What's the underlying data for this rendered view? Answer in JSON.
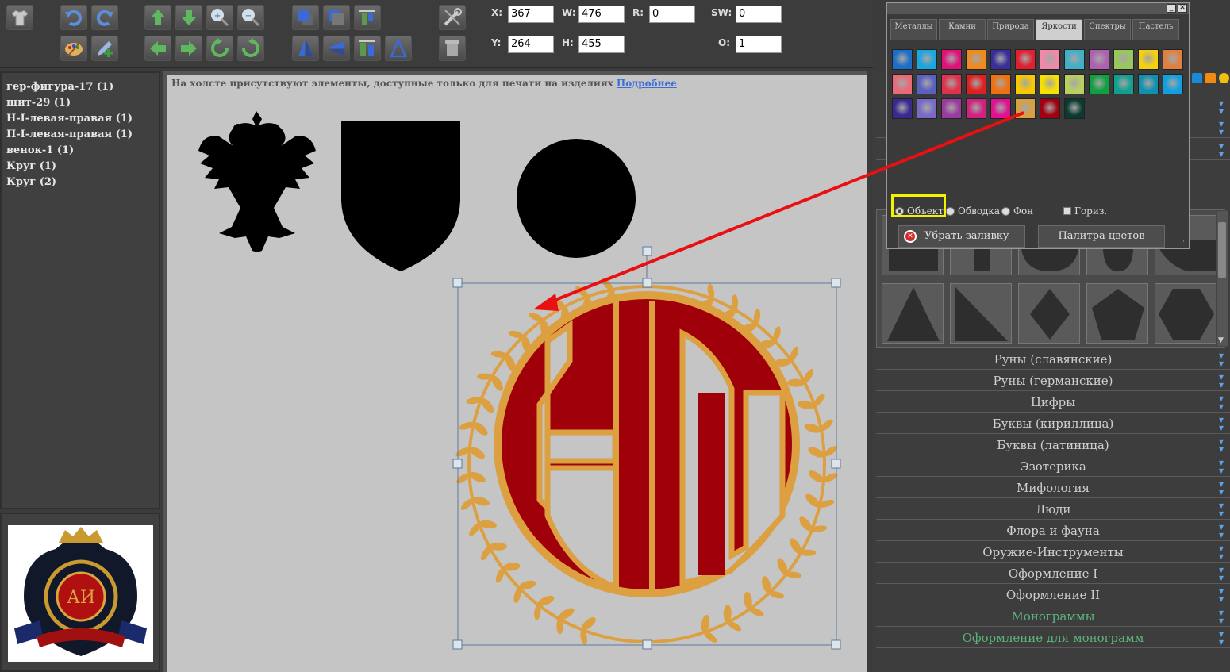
{
  "toolbar": {
    "fields": {
      "x_label": "X:",
      "x_value": "367",
      "y_label": "Y:",
      "y_value": "264",
      "w_label": "W:",
      "w_value": "476",
      "h_label": "H:",
      "h_value": "455",
      "r_label": "R:",
      "r_value": "0",
      "sw_label": "SW:",
      "sw_value": "0",
      "o_label": "O:",
      "o_value": "1"
    }
  },
  "layers": {
    "items": [
      "гер-фигура-17 (1)",
      "щит-29 (1)",
      "Н-I-левая-правая (1)",
      "П-I-левая-правая (1)",
      "венок-1 (1)",
      "Круг (1)",
      "Круг (2)"
    ]
  },
  "canvas": {
    "notice": "На холсте присутствуют элементы, доступные только для печати на изделиях",
    "notice_link": "Подробнее"
  },
  "color_popup": {
    "tabs": [
      "Металлы",
      "Камни",
      "Природа",
      "Яркости",
      "Спектры",
      "Пастель"
    ],
    "active_tab": "Яркости",
    "swatches": [
      [
        "#1b6fc8",
        "#1aa6e0",
        "#e0127a",
        "#f08a1c",
        "#3a2f9a",
        "#e02030",
        "#f08aa8",
        "#40b0c8",
        "#b060b0",
        "#98c85a",
        "#f4d010",
        "#e08040"
      ],
      [
        "#e86a78",
        "#5a60c0",
        "#e0304a",
        "#e02020",
        "#f07010",
        "#f8c800",
        "#f8e000",
        "#b8d060",
        "#10a040",
        "#10a090",
        "#1090b0",
        "#10a0e0"
      ],
      [
        "#3a2a90",
        "#7a6ac8",
        "#9a3aa0",
        "#d02080",
        "#e01090",
        "#d8a040",
        "#a00010",
        "#0a3a30"
      ]
    ],
    "options": {
      "object": "Объект",
      "stroke": "Обводка",
      "background": "Фон",
      "horizontal": "Гориз."
    },
    "remove_fill": "Убрать заливку",
    "palette": "Палитра цветов"
  },
  "categories": [
    {
      "label": "Руны (славянские)",
      "green": false
    },
    {
      "label": "Руны (германские)",
      "green": false
    },
    {
      "label": "Цифры",
      "green": false
    },
    {
      "label": "Буквы (кириллица)",
      "green": false
    },
    {
      "label": "Буквы (латиница)",
      "green": false
    },
    {
      "label": "Эзотерика",
      "green": false
    },
    {
      "label": "Мифология",
      "green": false
    },
    {
      "label": "Люди",
      "green": false
    },
    {
      "label": "Флора и фауна",
      "green": false
    },
    {
      "label": "Оружие-Инструменты",
      "green": false
    },
    {
      "label": "Оформление I",
      "green": false
    },
    {
      "label": "Оформление II",
      "green": false
    },
    {
      "label": "Монограммы",
      "green": true
    },
    {
      "label": "Оформление для монограмм",
      "green": true
    }
  ],
  "colors": {
    "monogram_red": "#a0000a",
    "monogram_gold": "#dca040",
    "selection": "#5a7a9a",
    "annotation_arrow": "#e81010",
    "highlight": "#f2f200"
  }
}
